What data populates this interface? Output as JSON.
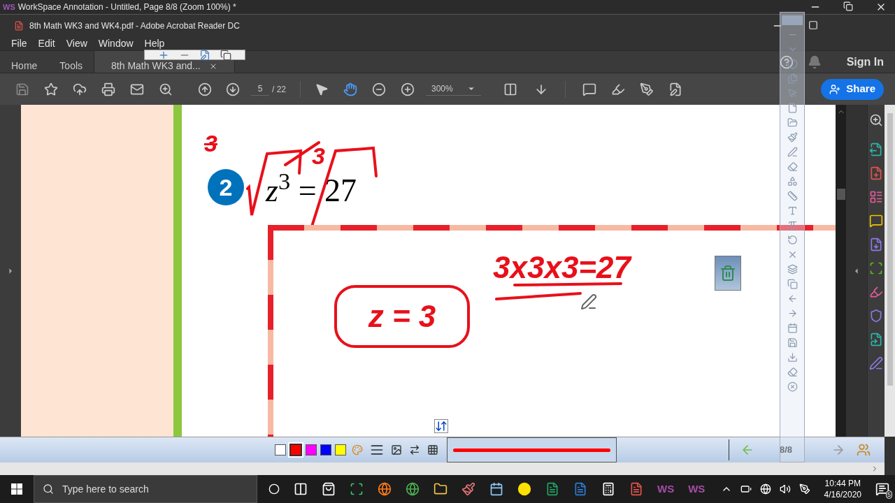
{
  "workspace": {
    "logo": "WS",
    "title": "WorkSpace Annotation - Untitled, Page 8/8  (Zoom 100%) *"
  },
  "acrobat": {
    "title": "8th Math WK3 and WK4.pdf - Adobe Acrobat Reader DC"
  },
  "menu": [
    "File",
    "Edit",
    "View",
    "Window",
    "Help"
  ],
  "tabs": [
    {
      "label": "Home",
      "selected": false
    },
    {
      "label": "Tools",
      "selected": false
    },
    {
      "label": "8th Math WK3 and...",
      "selected": true
    }
  ],
  "sign_in": "Sign In",
  "toolbar": {
    "page": "5",
    "total": "/ 22",
    "zoom": "300%",
    "share": "Share",
    "tools": [
      {
        "kind": "select",
        "selected": false
      },
      {
        "kind": "hand",
        "selected": true
      }
    ]
  },
  "document": {
    "problem_number": "2",
    "equation": "*z*$^{3}$ = 27",
    "ink": {
      "struck_index": "3",
      "root_index": "3",
      "product": "3x3x3=27",
      "answer": "z = 3"
    }
  },
  "ws_bar": {
    "colors": [
      {
        "color": "#ffffff",
        "selected": false
      },
      {
        "color": "#ff0000",
        "selected": true
      },
      {
        "color": "#ff00ff",
        "selected": false
      },
      {
        "color": "#0000ff",
        "selected": false
      },
      {
        "color": "#ffff00",
        "selected": false
      }
    ],
    "page": "8/8"
  },
  "taskbar": {
    "search_placeholder": "Type here to search",
    "apps": [
      "WS",
      "WS"
    ],
    "time": "10:44 PM",
    "date": "4/16/2020",
    "notifications": "5"
  }
}
